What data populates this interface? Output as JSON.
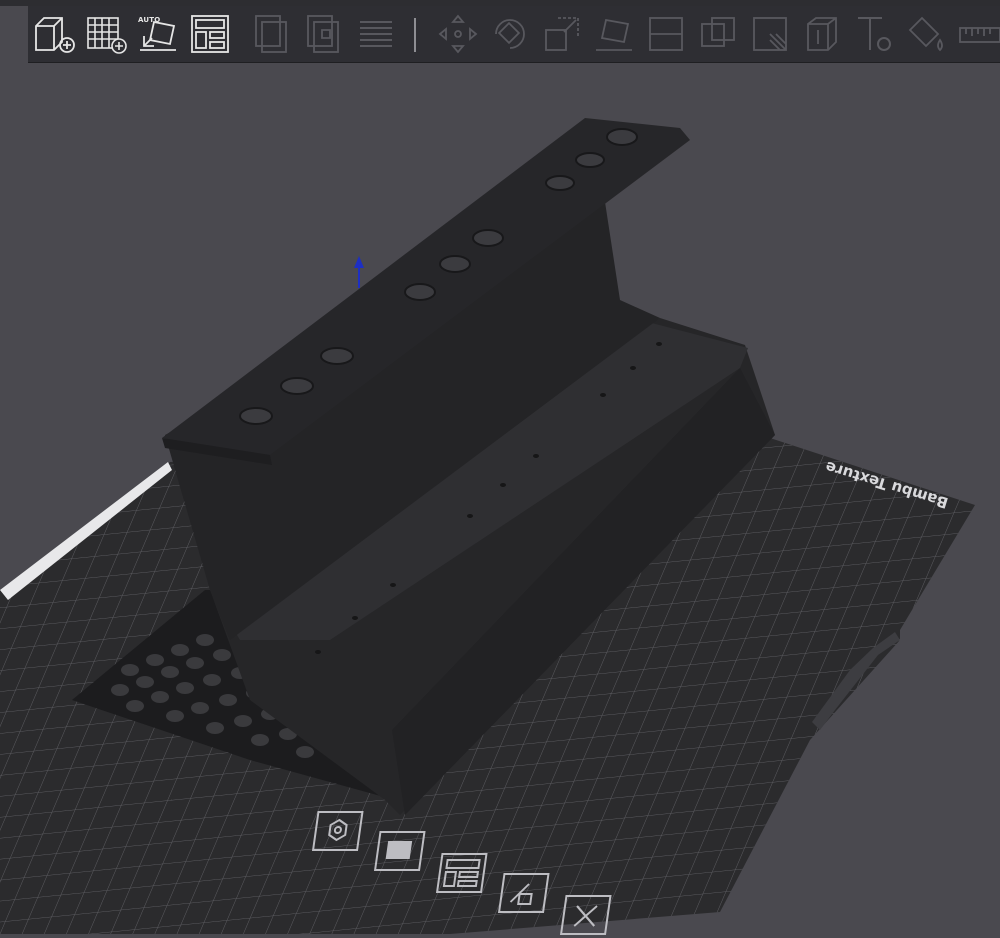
{
  "colors": {
    "background": "#4a494f",
    "toolbar_bg": "#2e2e33",
    "plate": "#2b2b2d",
    "grid": "#5e5e63",
    "model": "#232325",
    "model_light": "#2e2e31",
    "z_arrow": "#1d2fc4"
  },
  "toolbar": {
    "items": [
      {
        "name": "add-object-icon",
        "enabled": true
      },
      {
        "name": "add-plate-icon",
        "enabled": true
      },
      {
        "name": "auto-orient-icon",
        "enabled": true,
        "label": "AUTO"
      },
      {
        "name": "arrange-icon",
        "enabled": true
      },
      {
        "name": "copy-icon",
        "enabled": false
      },
      {
        "name": "paste-icon",
        "enabled": false
      },
      {
        "name": "layers-icon",
        "enabled": false
      },
      {
        "name": "move-icon",
        "enabled": false
      },
      {
        "name": "rotate-icon",
        "enabled": false
      },
      {
        "name": "scale-icon",
        "enabled": false
      },
      {
        "name": "lay-on-face-icon",
        "enabled": false
      },
      {
        "name": "cut-icon",
        "enabled": false
      },
      {
        "name": "boolean-icon",
        "enabled": false
      },
      {
        "name": "support-paint-icon",
        "enabled": false
      },
      {
        "name": "seam-paint-icon",
        "enabled": false
      },
      {
        "name": "emboss-icon",
        "enabled": false
      },
      {
        "name": "text-icon",
        "enabled": false
      },
      {
        "name": "color-paint-icon",
        "enabled": false
      },
      {
        "name": "measure-icon",
        "enabled": false
      }
    ]
  },
  "plate": {
    "brand_text": "Bambu Texture",
    "tools": [
      {
        "name": "plate-slice-icon"
      },
      {
        "name": "plate-lock-icon"
      },
      {
        "name": "plate-arrange-icon"
      },
      {
        "name": "plate-settings-icon"
      },
      {
        "name": "plate-delete-icon"
      }
    ]
  }
}
